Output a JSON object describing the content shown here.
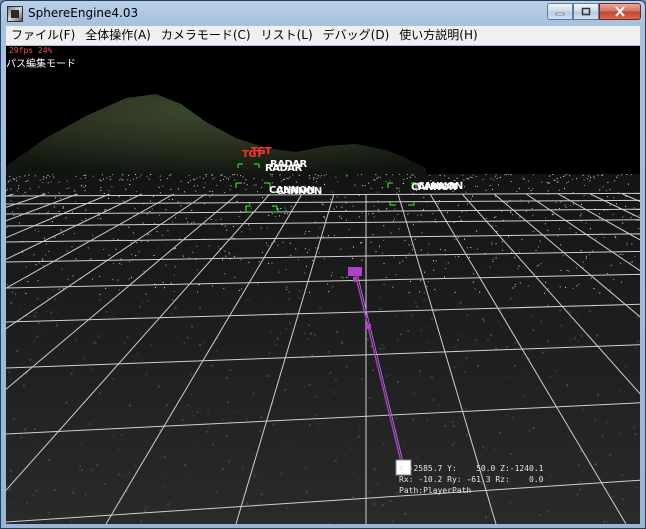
{
  "window": {
    "title": "SphereEngine4.03",
    "buttons": {
      "minimize": "minimize",
      "maximize": "maximize",
      "close": "close"
    }
  },
  "menu": [
    {
      "label": "ファイル(F)"
    },
    {
      "label": "全体操作(A)"
    },
    {
      "label": "カメラモード(C)"
    },
    {
      "label": "リスト(L)"
    },
    {
      "label": "デバッグ(D)"
    },
    {
      "label": "使い方説明(H)"
    }
  ],
  "hud": {
    "fps": "29fps  24%",
    "mode": "パス編集モード",
    "coords_line1": "X:-2585.7 Y:    50.0 Z:-1240.1",
    "coords_line2": "Rx: -10.2 Ry: -61.3 Rz:    0.0",
    "coords_line3": "Path:PlayerPath"
  },
  "scene_labels": {
    "tgt_a": "TGT",
    "tgt_b": "TGT",
    "radar_a": "RADAR",
    "radar_b": "RADAR",
    "cannon_a": "CANNON",
    "cannon_b": "CANNON",
    "cannon_c": "CANNON",
    "cannon_d": "CANNON"
  },
  "colors": {
    "target_label": "#ff3030",
    "marker_green": "#32ff32",
    "path_purple": "#a040c0",
    "grid": "#cfcfcf",
    "background": "#000000"
  }
}
